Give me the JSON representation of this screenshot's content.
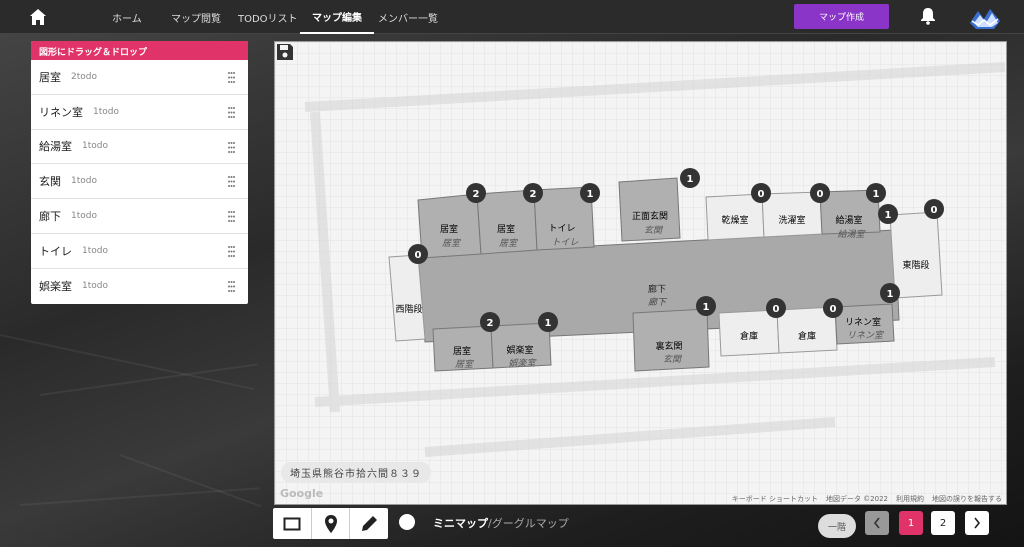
{
  "nav": {
    "items": [
      {
        "label": "ホーム"
      },
      {
        "label": "マップ閲覧"
      },
      {
        "label": "TODOリスト"
      },
      {
        "label": "マップ編集"
      },
      {
        "label": "メンバー一覧"
      }
    ],
    "active_index": 3,
    "create_label": "マップ作成"
  },
  "panel": {
    "title": "図形にドラッグ＆ドロップ",
    "items": [
      {
        "name": "居室",
        "count": "2todo"
      },
      {
        "name": "リネン室",
        "count": "1todo"
      },
      {
        "name": "給湯室",
        "count": "1todo"
      },
      {
        "name": "玄関",
        "count": "1todo"
      },
      {
        "name": "廊下",
        "count": "1todo"
      },
      {
        "name": "トイレ",
        "count": "1todo"
      },
      {
        "name": "娯楽室",
        "count": "1todo"
      }
    ]
  },
  "map": {
    "address": "埼玉県熊谷市拾六間８３９",
    "google_label": "Google",
    "attribution": [
      "キーボード ショートカット",
      "地図データ ©2022",
      "利用規約",
      "地図の誤りを報告する"
    ],
    "rooms": [
      {
        "name": "居室",
        "sub": "居室",
        "badge": "2"
      },
      {
        "name": "居室",
        "sub": "居室",
        "badge": "2"
      },
      {
        "name": "トイレ",
        "sub": "トイレ",
        "badge": "1"
      },
      {
        "name": "正面玄関",
        "sub": "玄関",
        "badge": "1"
      },
      {
        "name": "乾燥室",
        "sub": "",
        "badge": "0"
      },
      {
        "name": "洗濯室",
        "sub": "",
        "badge": "0"
      },
      {
        "name": "給湯室",
        "sub": "給湯室",
        "badge": "1"
      },
      {
        "name": "東階段",
        "sub": "",
        "badge": "0"
      },
      {
        "name": "西階段",
        "sub": "",
        "badge": "0"
      },
      {
        "name": "廊下",
        "sub": "廊下",
        "badge": "1"
      },
      {
        "name": "居室",
        "sub": "居室",
        "badge": "2"
      },
      {
        "name": "娯楽室",
        "sub": "娯楽室",
        "badge": "1"
      },
      {
        "name": "裏玄関",
        "sub": "玄関",
        "badge": "1"
      },
      {
        "name": "倉庫",
        "sub": "",
        "badge": "0"
      },
      {
        "name": "倉庫",
        "sub": "",
        "badge": "0"
      },
      {
        "name": "リネン室",
        "sub": "リネン室",
        "badge": "1"
      }
    ]
  },
  "bottom": {
    "mini_map": "ミニマップ",
    "separator": "/",
    "google_map": "グーグルマップ",
    "floor": "一階",
    "pages": [
      "1",
      "2"
    ],
    "current_page": "1"
  },
  "colors": {
    "accent_purple": "#8a35c8",
    "header_pink": "#e0336a",
    "page_active": "#e0336a"
  }
}
